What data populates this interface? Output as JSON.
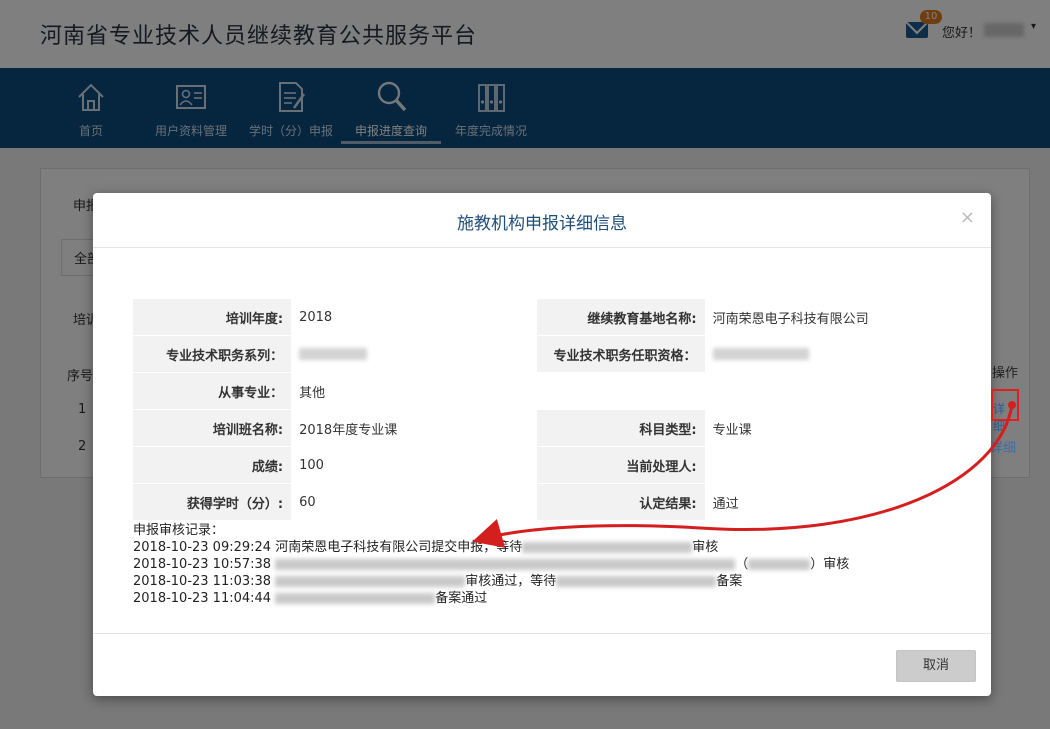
{
  "header": {
    "site_title": "河南省专业技术人员继续教育公共服务平台",
    "mail_count": "10",
    "greeting": "您好！",
    "caret": "▾"
  },
  "nav": {
    "items": [
      {
        "label": "首页",
        "icon": "home-icon"
      },
      {
        "label": "用户资料管理",
        "icon": "id-card-icon"
      },
      {
        "label": "学时（分）申报",
        "icon": "form-edit-icon"
      },
      {
        "label": "申报进度查询",
        "icon": "search-icon",
        "active": true
      },
      {
        "label": "年度完成情况",
        "icon": "binders-icon"
      }
    ]
  },
  "background": {
    "frag_1": "申报",
    "frag_2": "全部",
    "frag_3": "培训",
    "col_index": "序号",
    "row_1": "1",
    "row_2": "2",
    "col_action": "操作",
    "action_1": "详细",
    "action_2": "详细"
  },
  "modal": {
    "title": "施教机构申报详细信息",
    "close": "×",
    "fields": [
      {
        "label": "培训年度:",
        "value": "2018",
        "label2": "继续教育基地名称:",
        "value2": "河南荣恩电子科技有限公司"
      },
      {
        "label": "专业技术职务系列：",
        "value": "",
        "label2": "专业技术职务任职资格：",
        "value2": ""
      },
      {
        "label": "从事专业：",
        "value": "其他",
        "label2": "",
        "value2": ""
      },
      {
        "label": "培训班名称:",
        "value": "2018年度专业课",
        "label2": "科目类型:",
        "value2": "专业课"
      },
      {
        "label": "成绩:",
        "value": "100",
        "label2": "当前处理人:",
        "value2": ""
      },
      {
        "label": "获得学时（分）:",
        "value": "60",
        "label2": "认定结果:",
        "value2": "通过"
      }
    ],
    "audit_title": "申报审核记录：",
    "audit": [
      {
        "time": "2018-10-23 09:29:24",
        "text_a": "河南荣恩电子科技有限公司提交申报，等待",
        "text_b": "审核"
      },
      {
        "time": "2018-10-23 10:57:38",
        "text_a": "",
        "text_b": "（",
        "text_c": "）审核"
      },
      {
        "time": "2018-10-23 11:03:38",
        "text_a": "审核通过，等待",
        "text_b": "备案"
      },
      {
        "time": "2018-10-23 11:04:44",
        "text_a": "备案通过",
        "text_b": ""
      }
    ],
    "cancel_label": "取消"
  },
  "colors": {
    "nav_bg": "#0d4a7e",
    "title": "#1f4e79",
    "annotation": "#e02020"
  }
}
